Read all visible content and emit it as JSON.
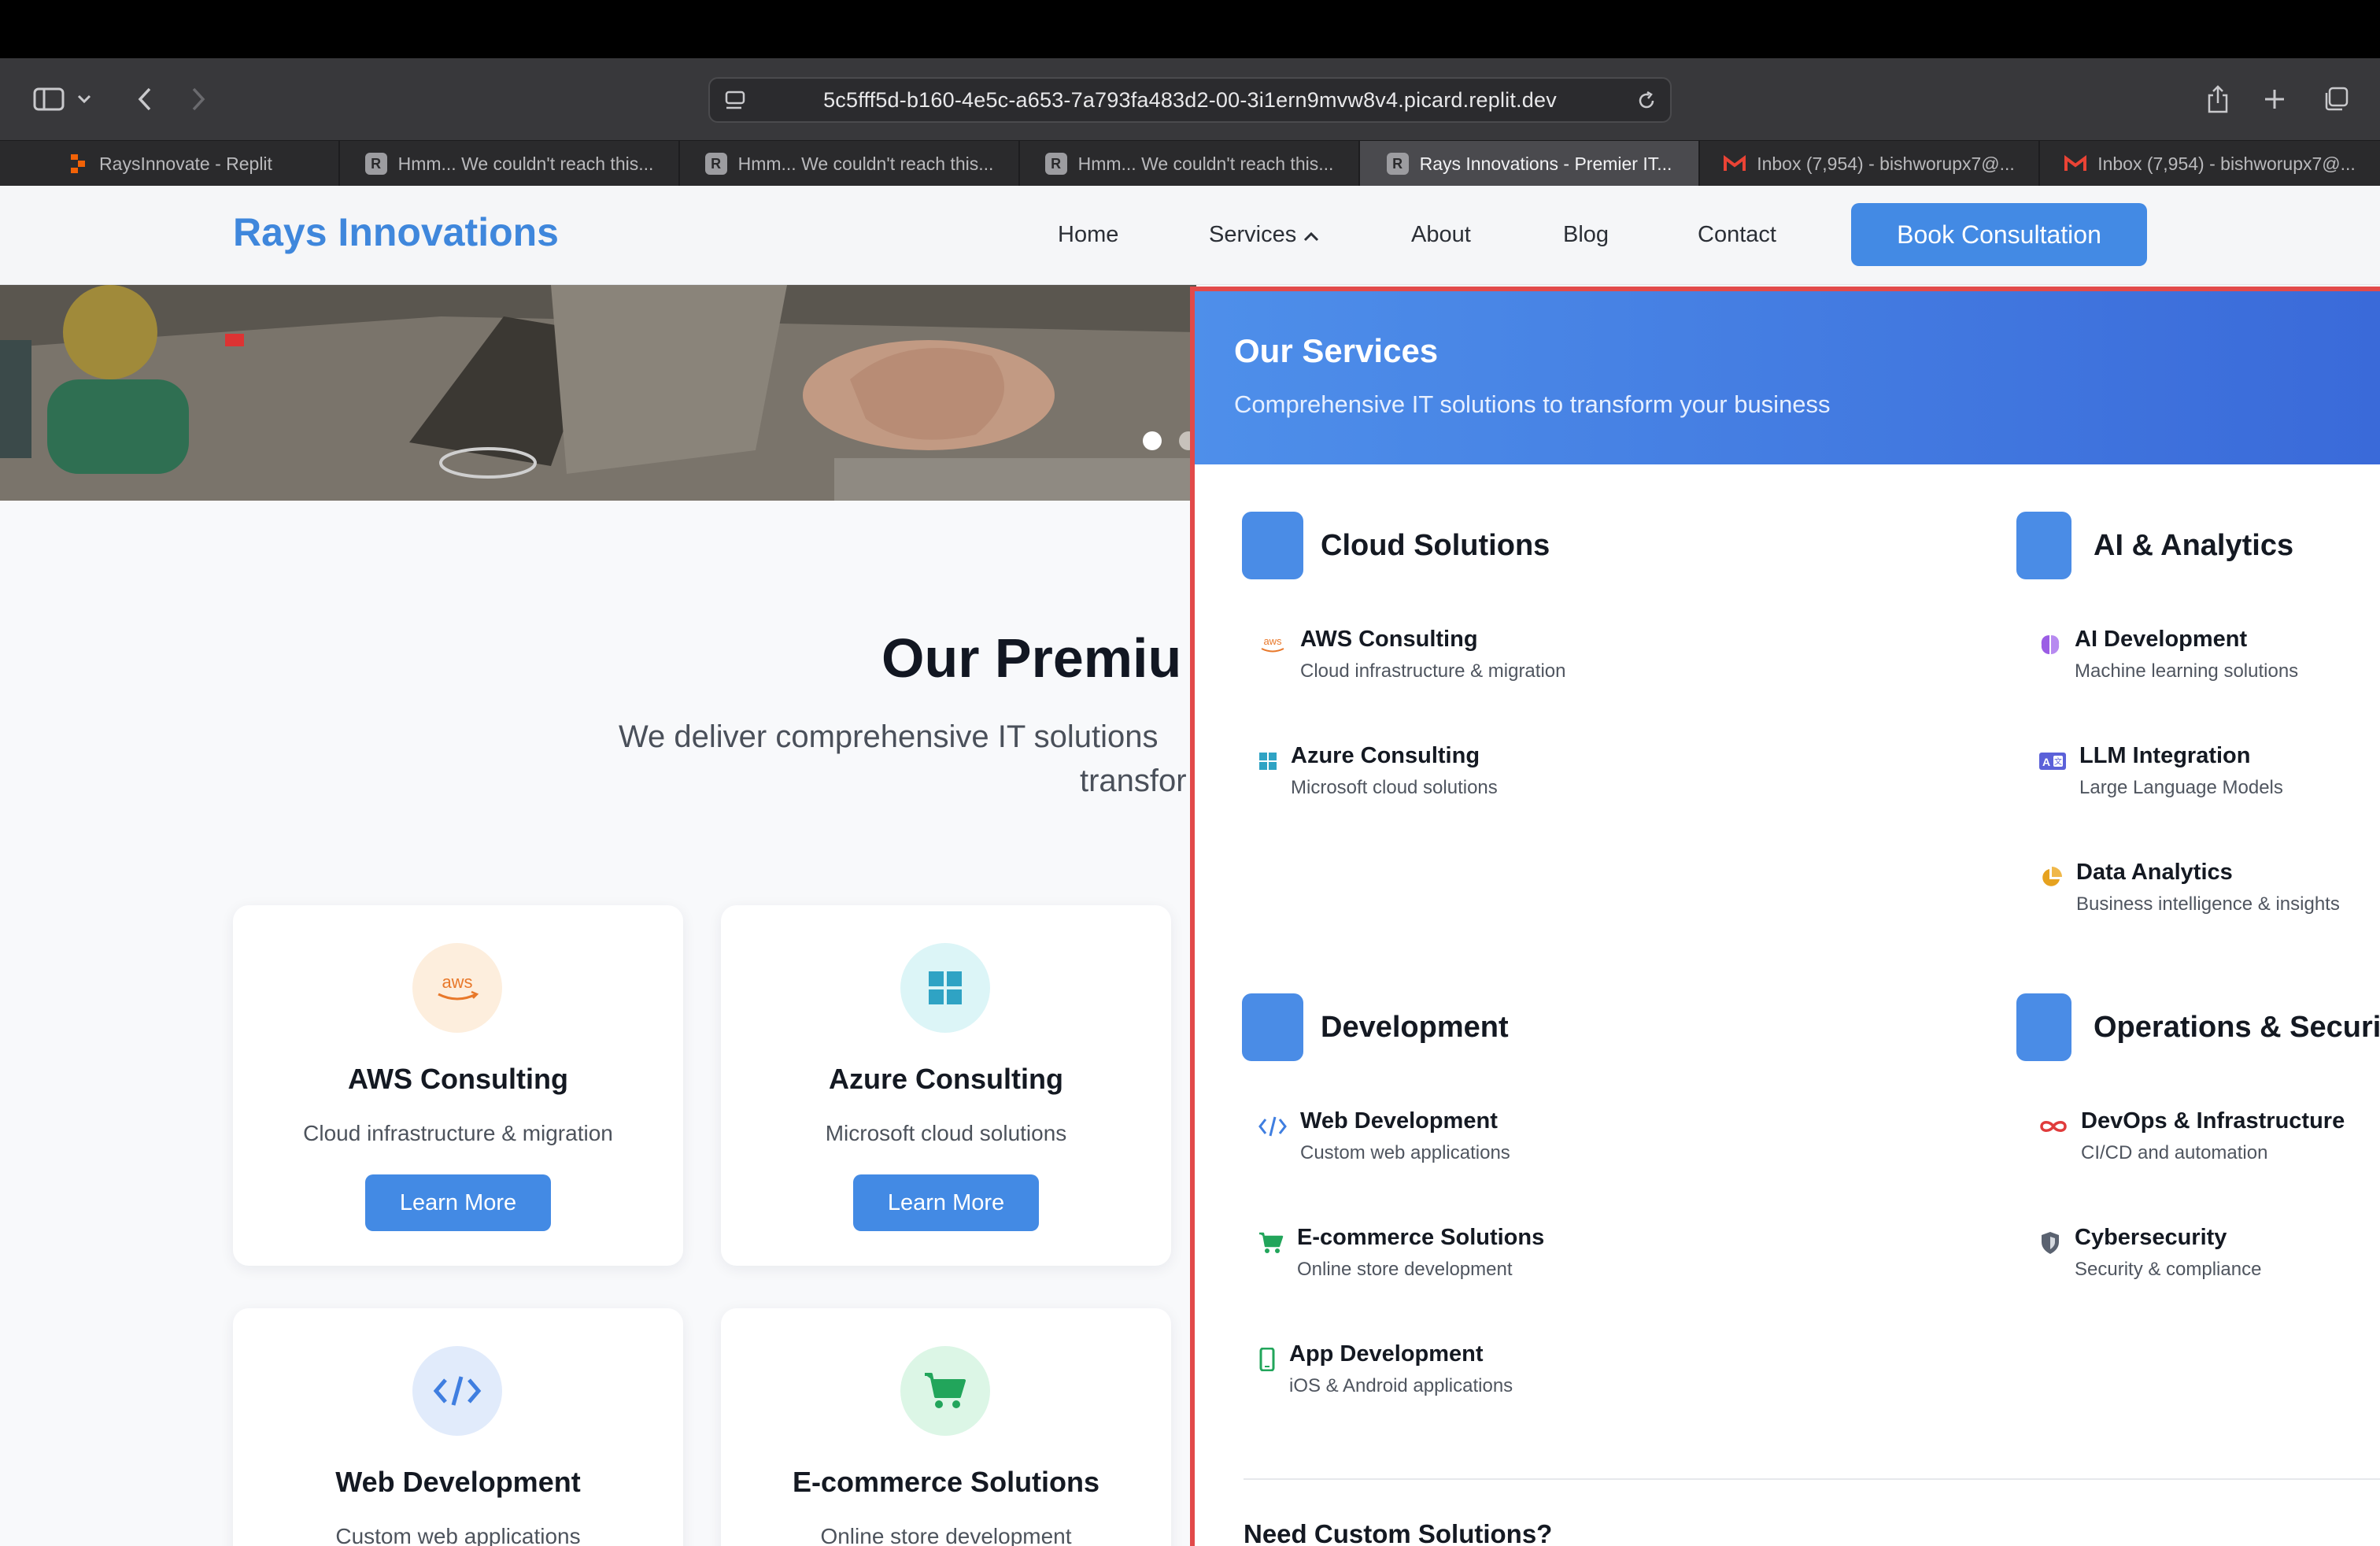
{
  "browser": {
    "url": "5c5fff5d-b160-4e5c-a653-7a793fa483d2-00-3i1ern9mvw8v4.picard.replit.dev",
    "tabs": [
      {
        "title": "RaysInnovate - Replit",
        "favicon": "replit-icon"
      },
      {
        "title": "Hmm... We couldn't reach this...",
        "favicon": "R"
      },
      {
        "title": "Hmm... We couldn't reach this...",
        "favicon": "R"
      },
      {
        "title": "Hmm... We couldn't reach this...",
        "favicon": "R"
      },
      {
        "title": "Rays Innovations - Premier IT...",
        "favicon": "R",
        "active": true
      },
      {
        "title": "Inbox (7,954) - bishworupx7@...",
        "favicon": "gmail-icon"
      },
      {
        "title": "Inbox (7,954) - bishworupx7@...",
        "favicon": "gmail-icon"
      }
    ]
  },
  "site": {
    "logo": "Rays Innovations",
    "nav": {
      "home": "Home",
      "services": "Services",
      "about": "About",
      "blog": "Blog",
      "contact": "Contact",
      "cta": "Book Consultation"
    }
  },
  "main": {
    "title": "Our Premiu",
    "subtitle_line1": "We deliver comprehensive IT solutions",
    "subtitle_line2": "transfor",
    "cards": [
      {
        "title": "AWS Consulting",
        "desc": "Cloud infrastructure & migration",
        "button": "Learn More",
        "icon": "aws-icon"
      },
      {
        "title": "Azure Consulting",
        "desc": "Microsoft cloud solutions",
        "button": "Learn More",
        "icon": "windows-icon"
      },
      {
        "title": "Web Development",
        "desc": "Custom web applications",
        "icon": "code-icon"
      },
      {
        "title": "E-commerce Solutions",
        "desc": "Online store development",
        "icon": "cart-icon"
      }
    ]
  },
  "mega": {
    "title": "Our Services",
    "subtitle": "Comprehensive IT solutions to transform your business",
    "categories": [
      {
        "title": "Cloud Solutions",
        "items": [
          {
            "title": "AWS Consulting",
            "desc": "Cloud infrastructure & migration",
            "icon": "aws-icon"
          },
          {
            "title": "Azure Consulting",
            "desc": "Microsoft cloud solutions",
            "icon": "windows-icon"
          }
        ]
      },
      {
        "title": "AI & Analytics",
        "items": [
          {
            "title": "AI Development",
            "desc": "Machine learning solutions",
            "icon": "brain-icon"
          },
          {
            "title": "LLM Integration",
            "desc": "Large Language Models",
            "icon": "language-icon"
          },
          {
            "title": "Data Analytics",
            "desc": "Business intelligence & insights",
            "icon": "pie-chart-icon"
          }
        ]
      },
      {
        "title": "Development",
        "items": [
          {
            "title": "Web Development",
            "desc": "Custom web applications",
            "icon": "code-icon"
          },
          {
            "title": "E-commerce Solutions",
            "desc": "Online store development",
            "icon": "cart-icon"
          },
          {
            "title": "App Development",
            "desc": "iOS & Android applications",
            "icon": "mobile-icon"
          }
        ]
      },
      {
        "title": "Operations & Securit",
        "items": [
          {
            "title": "DevOps & Infrastructure",
            "desc": "CI/CD and automation",
            "icon": "infinity-icon"
          },
          {
            "title": "Cybersecurity",
            "desc": "Security & compliance",
            "icon": "shield-icon"
          }
        ]
      }
    ],
    "footer_title": "Need Custom Solutions?"
  },
  "colors": {
    "brand": "#3f87dc",
    "cta": "#438ae4",
    "menu_border": "#e24a4a",
    "aws": "#e8782a",
    "azure": "#2fa3c4",
    "ai": "#9b5de5",
    "ecommerce": "#22a55b",
    "devops": "#e03b3b"
  }
}
